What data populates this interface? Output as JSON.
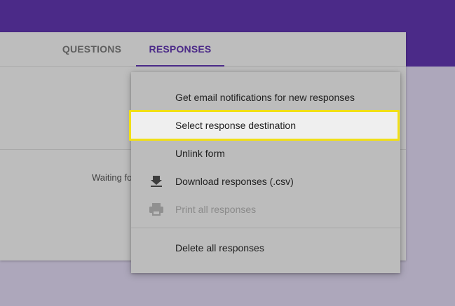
{
  "tabs": [
    {
      "label": "QUESTIONS"
    },
    {
      "label": "RESPONSES"
    }
  ],
  "main": {
    "waiting_text": "Waiting fo"
  },
  "menu": {
    "items": [
      {
        "label": "Get email notifications for new responses"
      },
      {
        "label": "Select response destination",
        "highlighted": true
      },
      {
        "label": "Unlink form"
      },
      {
        "label": "Download responses (.csv)",
        "icon": "download-icon"
      },
      {
        "label": "Print all responses",
        "icon": "print-icon",
        "disabled": true
      },
      {
        "label": "Delete all responses"
      }
    ]
  },
  "colors": {
    "header": "#4b2a88",
    "highlight_border": "#f1df16",
    "active_tab": "#4b2a88"
  }
}
